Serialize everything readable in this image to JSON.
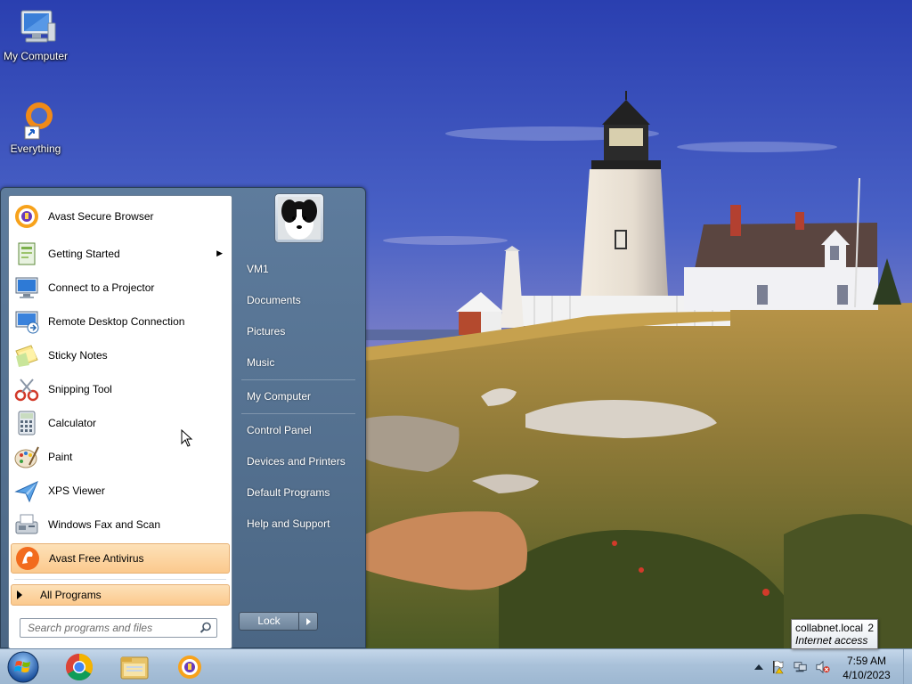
{
  "desktop": {
    "icons": [
      {
        "label": "My Computer"
      },
      {
        "label": "Everything"
      }
    ]
  },
  "start_menu": {
    "programs": [
      {
        "label": "Avast Secure Browser",
        "icon": "avast-browser-icon"
      },
      {
        "label": "Getting Started",
        "icon": "getting-started-icon",
        "has_submenu": true
      },
      {
        "label": "Connect to a Projector",
        "icon": "projector-icon"
      },
      {
        "label": "Remote Desktop Connection",
        "icon": "remote-desktop-icon"
      },
      {
        "label": "Sticky Notes",
        "icon": "sticky-notes-icon"
      },
      {
        "label": "Snipping Tool",
        "icon": "scissors-icon"
      },
      {
        "label": "Calculator",
        "icon": "calculator-icon"
      },
      {
        "label": "Paint",
        "icon": "paint-palette-icon"
      },
      {
        "label": "XPS Viewer",
        "icon": "xps-viewer-icon"
      },
      {
        "label": "Windows Fax and Scan",
        "icon": "fax-icon"
      },
      {
        "label": "Avast Free Antivirus",
        "icon": "avast-antivirus-icon",
        "highlighted": true
      }
    ],
    "all_programs": "All Programs",
    "search_placeholder": "Search programs and files",
    "right_links": [
      "VM1",
      "Documents",
      "Pictures",
      "Music",
      "My Computer",
      "Control Panel",
      "Devices and Printers",
      "Default Programs",
      "Help and Support"
    ],
    "lock_label": "Lock"
  },
  "taskbar": {
    "pinned": [
      "start-orb-icon",
      "chrome-icon",
      "file-explorer-icon",
      "avast-browser-icon"
    ],
    "clock": {
      "time": "7:59 AM",
      "date": "4/10/2023"
    }
  },
  "tooltip": {
    "network": "collabnet.local",
    "number": "2",
    "status": "Internet access"
  },
  "colors": {
    "highlight": "#fbc98d",
    "start_menu_frame": "#5f7d9b",
    "taskbar": "#a9c1d9"
  }
}
